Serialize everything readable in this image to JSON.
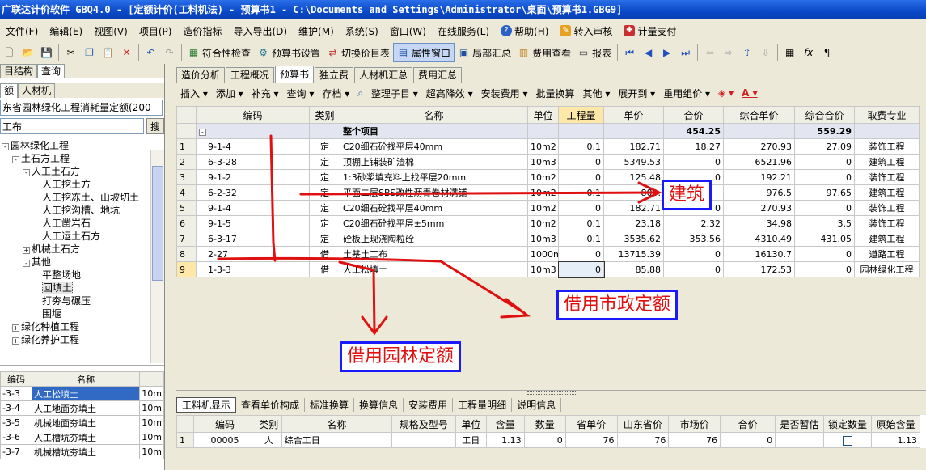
{
  "window": {
    "title": "广联达计价软件 GBQ4.0 - [定额计价(工料机法) - 预算书1 - C:\\Documents and Settings\\Administrator\\桌面\\预算书1.GBG9]"
  },
  "menu": [
    "文件(F)",
    "编辑(E)",
    "视图(V)",
    "项目(P)",
    "造价指标",
    "导入导出(D)",
    "维护(M)",
    "系统(S)",
    "窗口(W)",
    "在线服务(L)",
    "帮助(H)",
    "转入审核",
    "计量支付"
  ],
  "toolbar": {
    "check": "符合性检查",
    "setting": "预算书设置",
    "switch": "切换价目表",
    "attr": "属性窗口",
    "summary": "局部汇总",
    "fee_view": "费用查看",
    "report": "报表"
  },
  "left": {
    "tabs": [
      "目结构",
      "查询"
    ],
    "subtabs": [
      "额",
      "人材机"
    ],
    "dropdown": "东省园林绿化工程消耗量定额(200",
    "search_value": "工布",
    "search_button": "搜",
    "tree": [
      {
        "t": "园林绿化工程",
        "l": 0,
        "pm": "-"
      },
      {
        "t": "土石方工程",
        "l": 1,
        "pm": "-"
      },
      {
        "t": "人工土石方",
        "l": 2,
        "pm": "-"
      },
      {
        "t": "人工挖土方",
        "l": 3,
        "pm": ""
      },
      {
        "t": "人工挖冻土、山坡切土",
        "l": 3,
        "pm": ""
      },
      {
        "t": "人工挖沟槽、地坑",
        "l": 3,
        "pm": ""
      },
      {
        "t": "人工凿岩石",
        "l": 3,
        "pm": ""
      },
      {
        "t": "人工运土石方",
        "l": 3,
        "pm": ""
      },
      {
        "t": "机械土石方",
        "l": 2,
        "pm": "+"
      },
      {
        "t": "其他",
        "l": 2,
        "pm": "-"
      },
      {
        "t": "平整场地",
        "l": 3,
        "pm": ""
      },
      {
        "t": "回填土",
        "l": 3,
        "pm": "",
        "sel": true
      },
      {
        "t": "打夯与碾压",
        "l": 3,
        "pm": ""
      },
      {
        "t": "围堰",
        "l": 3,
        "pm": ""
      },
      {
        "t": "绿化种植工程",
        "l": 1,
        "pm": "+"
      },
      {
        "t": "绿化养护工程",
        "l": 1,
        "pm": "+"
      }
    ],
    "list_headers": [
      "编码",
      "名称",
      ""
    ],
    "list_rows": [
      [
        "-3-3",
        "人工松填土",
        "10m"
      ],
      [
        "-3-4",
        "人工地面夯填土",
        "10m"
      ],
      [
        "-3-5",
        "机械地面夯填土",
        "10m"
      ],
      [
        "-3-6",
        "人工槽坑夯填土",
        "10m"
      ],
      [
        "-3-7",
        "机械槽坑夯填土",
        "10m"
      ]
    ]
  },
  "tabs_top": [
    "造价分析",
    "工程概况",
    "预算书",
    "独立费",
    "人材机汇总",
    "费用汇总"
  ],
  "subbar": [
    "插入 ▾",
    "添加 ▾",
    "补充 ▾",
    "查询 ▾",
    "存档 ▾",
    "整理子目 ▾",
    "超高降效 ▾",
    "安装费用 ▾",
    "批量换算",
    "其他 ▾",
    "展开到 ▾",
    "重用组价 ▾"
  ],
  "grid": {
    "headers": [
      "",
      "编码",
      "类别",
      "名称",
      "单位",
      "工程量",
      "单价",
      "合价",
      "综合单价",
      "综合合价",
      "取费专业"
    ],
    "total": {
      "name": "整个项目",
      "hj": "454.25",
      "zhhj": "559.29"
    },
    "rows": [
      [
        "1",
        "9-1-4",
        "定",
        "C20细石砼找平层40mm",
        "10m2",
        "0.1",
        "182.71",
        "18.27",
        "270.93",
        "27.09",
        "装饰工程"
      ],
      [
        "2",
        "6-3-28",
        "定",
        "顶棚上铺装矿渣棉",
        "10m3",
        "0",
        "5349.53",
        "0",
        "6521.96",
        "0",
        "建筑工程"
      ],
      [
        "3",
        "9-1-2",
        "定",
        "1:3砂浆填充料上找平层20mm",
        "10m2",
        "0",
        "125.48",
        "0",
        "192.21",
        "0",
        "装饰工程"
      ],
      [
        "4",
        "6-2-32",
        "定",
        "平面二层SBS改性沥青卷材满铺",
        "10m2",
        "0.1",
        "800.",
        "",
        "976.5",
        "97.65",
        "建筑工程"
      ],
      [
        "5",
        "9-1-4",
        "定",
        "C20细石砼找平层40mm",
        "10m2",
        "0",
        "182.71",
        "0",
        "270.93",
        "0",
        "装饰工程"
      ],
      [
        "6",
        "9-1-5",
        "定",
        "C20细石砼找平层±5mm",
        "10m2",
        "0.1",
        "23.18",
        "2.32",
        "34.98",
        "3.5",
        "装饰工程"
      ],
      [
        "7",
        "6-3-17",
        "定",
        "砼板上现浇陶粒砼",
        "10m3",
        "0.1",
        "3535.62",
        "353.56",
        "4310.49",
        "431.05",
        "建筑工程"
      ],
      [
        "8",
        "2-27",
        "借",
        "土基土工布",
        "1000m2",
        "0",
        "13715.39",
        "0",
        "16130.7",
        "0",
        "道路工程"
      ],
      [
        "9",
        "1-3-3",
        "借",
        "人工松填土",
        "10m3",
        "0",
        "85.88",
        "0",
        "172.53",
        "0",
        "园林绿化工程"
      ]
    ]
  },
  "bottom_tabs": [
    "工料机显示",
    "查看单价构成",
    "标准换算",
    "换算信息",
    "安装费用",
    "工程量明细",
    "说明信息"
  ],
  "grid2": {
    "headers": [
      "",
      "编码",
      "类别",
      "名称",
      "规格及型号",
      "单位",
      "含量",
      "数量",
      "省单价",
      "山东省价",
      "市场价",
      "合价",
      "是否暂估",
      "锁定数量",
      "原始含量"
    ],
    "rows": [
      [
        "1",
        "00005",
        "人",
        "综合工日",
        "",
        "工日",
        "1.13",
        "0",
        "76",
        "76",
        "76",
        "0",
        "",
        "",
        "1.13"
      ]
    ]
  },
  "annotations": {
    "jianzhu": "建筑",
    "shizheng": "借用市政定额",
    "yuanlin": "借用园林定额"
  },
  "colors": {
    "title": "#0a48c8",
    "annotation_text": "#e01010",
    "annotation_border": "#1a1aff",
    "arrow": "#e01010"
  }
}
